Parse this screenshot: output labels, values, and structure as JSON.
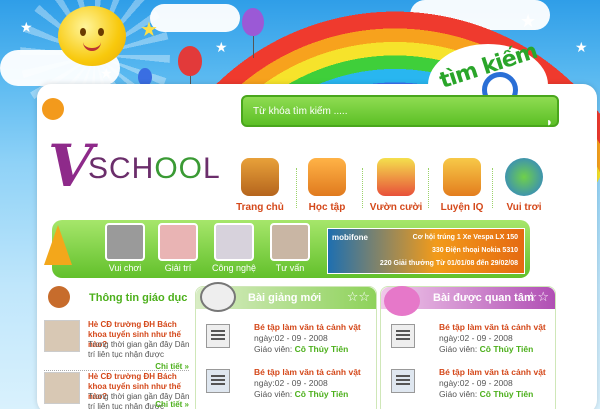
{
  "colors": {
    "accent_green": "#4db01c",
    "accent_orange": "#d4481a",
    "header_green": "#6fce35"
  },
  "header": {
    "logo_text": "vischool",
    "search_badge": "tìm kiếm",
    "search_placeholder": "Từ khóa tìm kiếm ....."
  },
  "nav": [
    {
      "label": "Trang chủ",
      "icon": "house-icon"
    },
    {
      "label": "Học tập",
      "icon": "lamp-book-icon"
    },
    {
      "label": "Vườn cười",
      "icon": "clown-icon"
    },
    {
      "label": "Luyện IQ",
      "icon": "blocks-icon"
    },
    {
      "label": "Vui trơi",
      "icon": "globe-icon"
    }
  ],
  "strip": [
    {
      "label": "Vui chơi"
    },
    {
      "label": "Giải trí"
    },
    {
      "label": "Công nghệ"
    },
    {
      "label": "Tư vấn"
    }
  ],
  "ad": {
    "brand": "mobifone",
    "lines": [
      "Cơ hội trúng  1 Xe Vespa LX 150",
      "330 Điện thoại Nokia 5310",
      "220 Giải thưởng  Từ 01/01/08 đến 29/02/08"
    ]
  },
  "news": {
    "title": "Thông tin giáo dục",
    "items": [
      {
        "title": "Hè CĐ trường ĐH Bách khoa tuyển sinh như thế nào?",
        "desc": "Trong thời gian gần đây Dân trí liên tục nhận được",
        "more": "Chi tiết"
      },
      {
        "title": "Hè CĐ trường ĐH Bách khoa tuyển sinh như thế nào?",
        "desc": "Trong thời gian gần đây Dân trí liên tục nhận được",
        "more": "Chi tiết"
      }
    ]
  },
  "lessons": {
    "title": "Bài giảng mới",
    "items": [
      {
        "title": "Bé tập làm văn tả cảnh vật",
        "date": "ngày:02 - 09 - 2008",
        "teacher_label": "Giáo viên:",
        "teacher": "Cô Thủy Tiên"
      },
      {
        "title": "Bé tập làm văn tả cảnh vật",
        "date": "ngày:02 - 09 - 2008",
        "teacher_label": "Giáo viên:",
        "teacher": "Cô Thủy Tiên"
      }
    ]
  },
  "popular": {
    "title": "Bài được quan tâm",
    "items": [
      {
        "title": "Bé tập làm văn tả cảnh vật",
        "date": "ngày:02 - 09 - 2008",
        "teacher_label": "Giáo viên:",
        "teacher": "Cô Thủy Tiên"
      },
      {
        "title": "Bé tập làm văn tả cảnh vật",
        "date": "ngày:02 - 09 - 2008",
        "teacher_label": "Giáo viên:",
        "teacher": "Cô Thủy Tiên"
      }
    ]
  }
}
